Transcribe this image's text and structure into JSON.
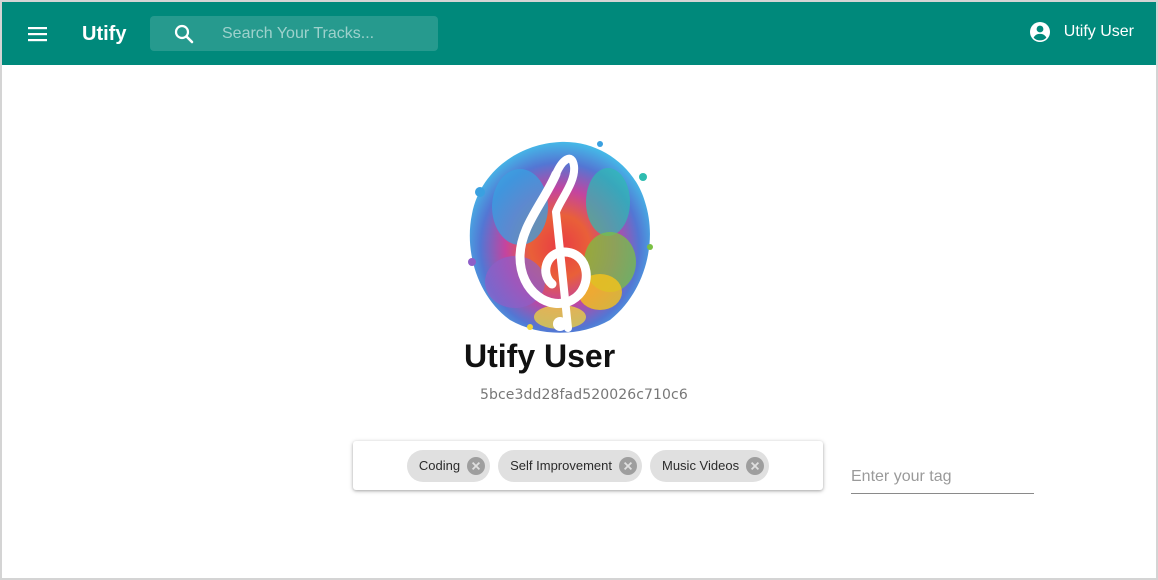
{
  "header": {
    "brand": "Utify",
    "search_placeholder": "Search Your Tracks...",
    "user_label": "Utify User",
    "bg_color": "#00897b"
  },
  "icons": {
    "menu": "menu-icon",
    "search": "search-icon",
    "account": "account-circle-icon",
    "chip_remove": "cancel-icon",
    "logo": "treble-clef-splash-logo"
  },
  "profile": {
    "name": "Utify User",
    "id": "5bce3dd28fad520026c710c6"
  },
  "tags": [
    {
      "label": "Coding"
    },
    {
      "label": "Self Improvement"
    },
    {
      "label": "Music Videos"
    }
  ],
  "tag_input": {
    "placeholder": "Enter your tag"
  }
}
